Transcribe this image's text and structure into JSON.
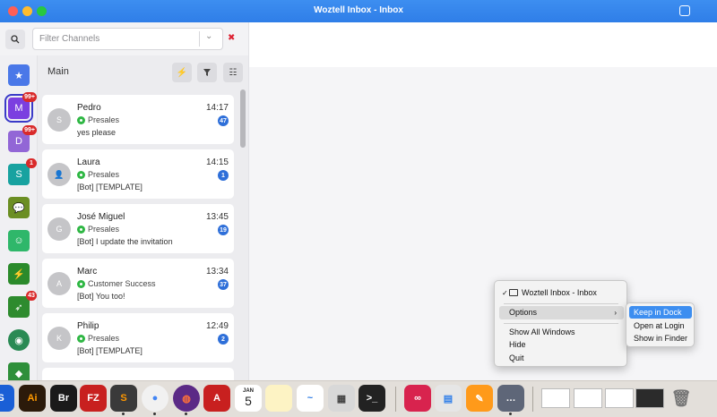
{
  "window": {
    "title": "Woztell Inbox - Inbox"
  },
  "filter": {
    "placeholder": "Filter Channels"
  },
  "list": {
    "title": "Main"
  },
  "channels": [
    {
      "letter": "★",
      "color": "#4a78e8",
      "badge": ""
    },
    {
      "letter": "M",
      "color": "#7b3fe0",
      "badge": "99+"
    },
    {
      "letter": "D",
      "color": "#9266d6",
      "badge": "99+"
    },
    {
      "letter": "S",
      "color": "#18a2a0",
      "badge": "1"
    },
    {
      "letter": "💬",
      "color": "#6b8e23",
      "badge": ""
    },
    {
      "letter": "☺",
      "color": "#2fb76a",
      "badge": ""
    },
    {
      "letter": "⚡",
      "color": "#2b8a2b",
      "badge": ""
    },
    {
      "letter": "➶",
      "color": "#2e8b2e",
      "badge": "43"
    },
    {
      "letter": "◉",
      "color": "#2a8a54",
      "badge": ""
    },
    {
      "letter": "◆",
      "color": "#2e8f3a",
      "badge": ""
    }
  ],
  "conversations": [
    {
      "avatar": "S",
      "name": "Pedro",
      "time": "14:17",
      "channel": "Presales",
      "preview": "yes please",
      "count": "47"
    },
    {
      "avatar": "👤",
      "name": "Laura",
      "time": "14:15",
      "channel": "Presales",
      "preview": "[Bot] [TEMPLATE]",
      "count": "1"
    },
    {
      "avatar": "G",
      "name": "José Miguel",
      "time": "13:45",
      "channel": "Presales",
      "preview": "[Bot] I update the invitation",
      "count": "19"
    },
    {
      "avatar": "A",
      "name": "Marc",
      "time": "13:34",
      "channel": "Customer Success",
      "preview": "[Bot] You too!",
      "count": "37"
    },
    {
      "avatar": "K",
      "name": "Philip",
      "time": "12:49",
      "channel": "Presales",
      "preview": "[Bot] [TEMPLATE]",
      "count": "2"
    }
  ],
  "menu": {
    "app_item": "Woztell Inbox - Inbox",
    "options": "Options",
    "show_all": "Show All Windows",
    "hide": "Hide",
    "quit": "Quit",
    "submenu": [
      "Keep in Dock",
      "Open at Login",
      "Show in Finder"
    ]
  },
  "dock": {
    "apps": [
      {
        "label": "Ai",
        "color": "#2b1a0a",
        "fg": "#ff9a00"
      },
      {
        "label": "Br",
        "color": "#1a1a1a",
        "fg": "#ffffff"
      },
      {
        "label": "FZ",
        "color": "#c8201f",
        "fg": "#ffffff"
      },
      {
        "label": "S",
        "color": "#3a3a3a",
        "fg": "#ff9800"
      },
      {
        "label": "●",
        "color": "#f1f1f1",
        "fg": "#4285f4"
      },
      {
        "label": "◍",
        "color": "#5b2a86",
        "fg": "#ff7139"
      },
      {
        "label": "A",
        "color": "#c8201f",
        "fg": "#ffffff"
      },
      {
        "label": "5",
        "color": "#ffffff",
        "fg": "#222222"
      },
      {
        "label": "",
        "color": "#fdf3c4",
        "fg": "#222222"
      },
      {
        "label": "~",
        "color": "#ffffff",
        "fg": "#2c7be5"
      },
      {
        "label": "▦",
        "color": "#d8d8d8",
        "fg": "#444444"
      },
      {
        "label": ">_",
        "color": "#222222",
        "fg": "#ffffff"
      },
      {
        "label": "∞",
        "color": "#d8234e",
        "fg": "#ffffff"
      },
      {
        "label": "▤",
        "color": "#e6e6e6",
        "fg": "#2f7ee8"
      },
      {
        "label": "✎",
        "color": "#ff9a1a",
        "fg": "#ffffff"
      },
      {
        "label": "…",
        "color": "#5e6678",
        "fg": "#ffffff"
      }
    ],
    "calendar_month": "JAN"
  }
}
